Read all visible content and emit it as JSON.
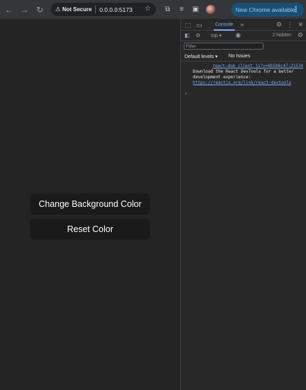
{
  "browser": {
    "security_label": "Not Secure",
    "url": "0.0.0.0:5173",
    "update_label": "New Chrome available"
  },
  "page": {
    "buttons": [
      {
        "label": "Change Background Color"
      },
      {
        "label": "Reset Color"
      }
    ]
  },
  "devtools": {
    "active_tab": "Console",
    "context": "top",
    "hidden_count": "2 hidden",
    "filter_placeholder": "Filter",
    "levels_label": "Default levels",
    "issues_label": "No Issues",
    "log": {
      "source": "react-dom_client.js?v=8b586c47:21534",
      "message": "Download the React DevTools for a better development experience: ",
      "link": "https://reactjs.org/link/react-devtools"
    }
  }
}
